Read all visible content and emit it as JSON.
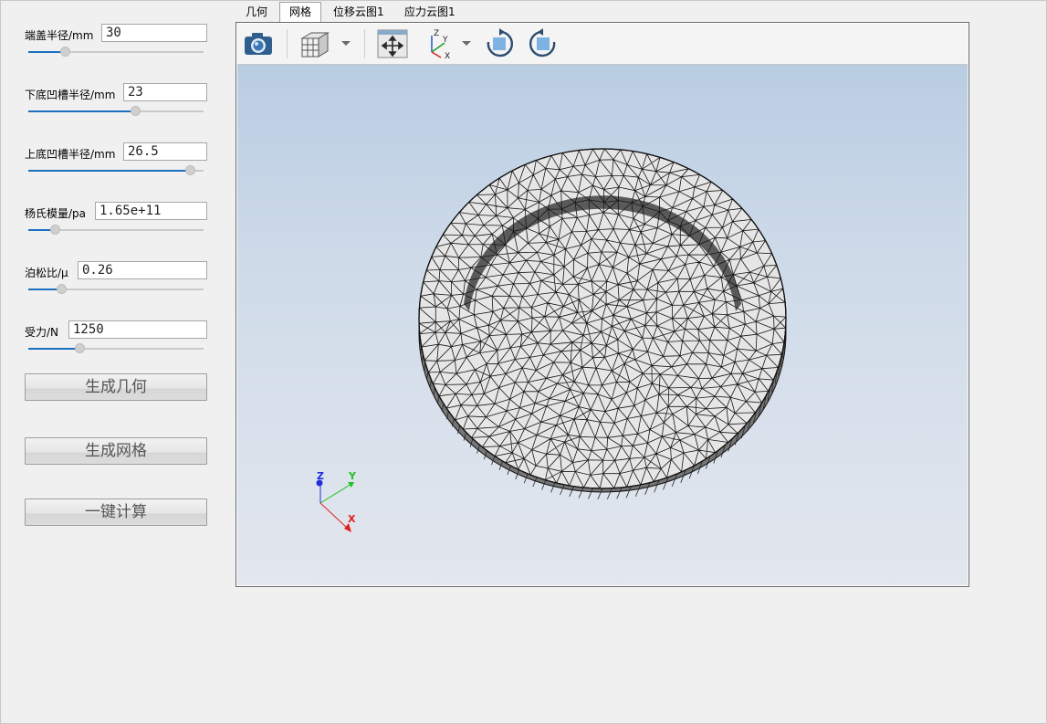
{
  "params": [
    {
      "label": "端盖半径/mm",
      "value": "30",
      "slider_fraction": 0.21
    },
    {
      "label": "下底凹槽半径/mm",
      "value": "23",
      "slider_fraction": 0.61
    },
    {
      "label": "上底凹槽半径/mm",
      "value": "26.5",
      "slider_fraction": 0.92
    },
    {
      "label": "杨氏模量/pa",
      "value": "1.65e+11",
      "slider_fraction": 0.15
    },
    {
      "label": "泊松比/μ",
      "value": "0.26",
      "slider_fraction": 0.19
    },
    {
      "label": "受力/N",
      "value": "1250",
      "slider_fraction": 0.29
    }
  ],
  "buttons": {
    "generate_geometry": "生成几何",
    "generate_mesh": "生成网格",
    "compute": "一键计算"
  },
  "tabs": [
    {
      "label": "几何",
      "active": false
    },
    {
      "label": "网格",
      "active": true
    },
    {
      "label": "位移云图1",
      "active": false
    },
    {
      "label": "应力云图1",
      "active": false
    }
  ],
  "toolbar": {
    "icons": [
      "camera-icon",
      "view-cube-icon",
      "fit-view-icon",
      "axes-orientation-icon",
      "rotate-clockwise-icon",
      "rotate-counterclockwise-icon"
    ]
  },
  "triad": {
    "z": "Z",
    "y": "Y",
    "x": "X"
  },
  "triad_axis_labels": {
    "z": "Z",
    "y": "Y",
    "x": "X"
  },
  "colors": {
    "accent": "#1b6fc0",
    "mesh_face": "#e4e4e4",
    "mesh_side": "#8a8a8a",
    "axis_x": "#e02020",
    "axis_y": "#22c022",
    "axis_z": "#1f2fe0"
  }
}
